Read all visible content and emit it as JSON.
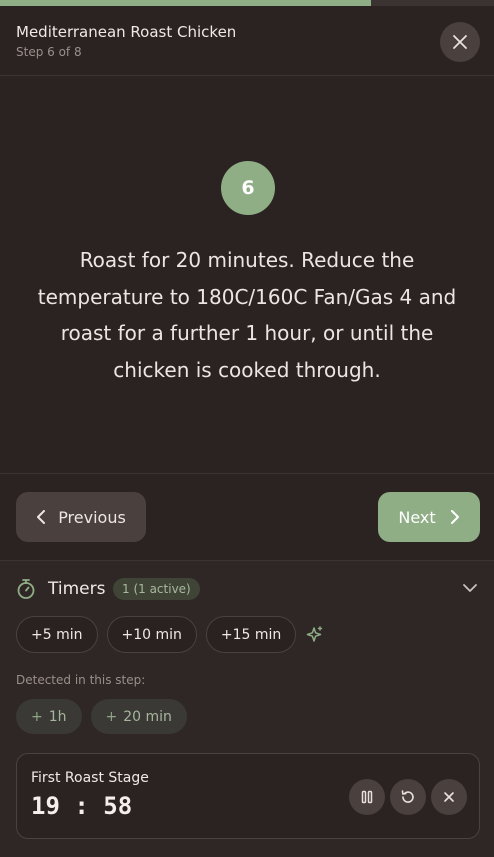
{
  "progress": {
    "fraction": 0.75
  },
  "header": {
    "recipe_title": "Mediterranean Roast Chicken",
    "step_indicator": "Step 6 of 8"
  },
  "step": {
    "number": "6",
    "instruction": "Roast for 20 minutes. Reduce the temperature to 180C/160C Fan/Gas 4 and roast for a further 1 hour, or until the chicken is cooked through."
  },
  "nav": {
    "previous_label": "Previous",
    "next_label": "Next"
  },
  "timers": {
    "label": "Timers",
    "badge": "1 (1 active)",
    "quick_add": [
      "+5 min",
      "+10 min",
      "+15 min"
    ],
    "detected_label": "Detected in this step:",
    "detected": [
      "1h",
      "20 min"
    ],
    "active": [
      {
        "name": "First Roast Stage",
        "time": "19:58"
      }
    ]
  },
  "colors": {
    "accent": "#8fae86",
    "background": "#2b2322",
    "button": "#4a403d"
  },
  "icons": [
    "close-icon",
    "chevron-left-icon",
    "chevron-right-icon",
    "stopwatch-icon",
    "chevron-down-icon",
    "sparkle-icon",
    "pause-icon",
    "reset-icon",
    "close-icon"
  ]
}
